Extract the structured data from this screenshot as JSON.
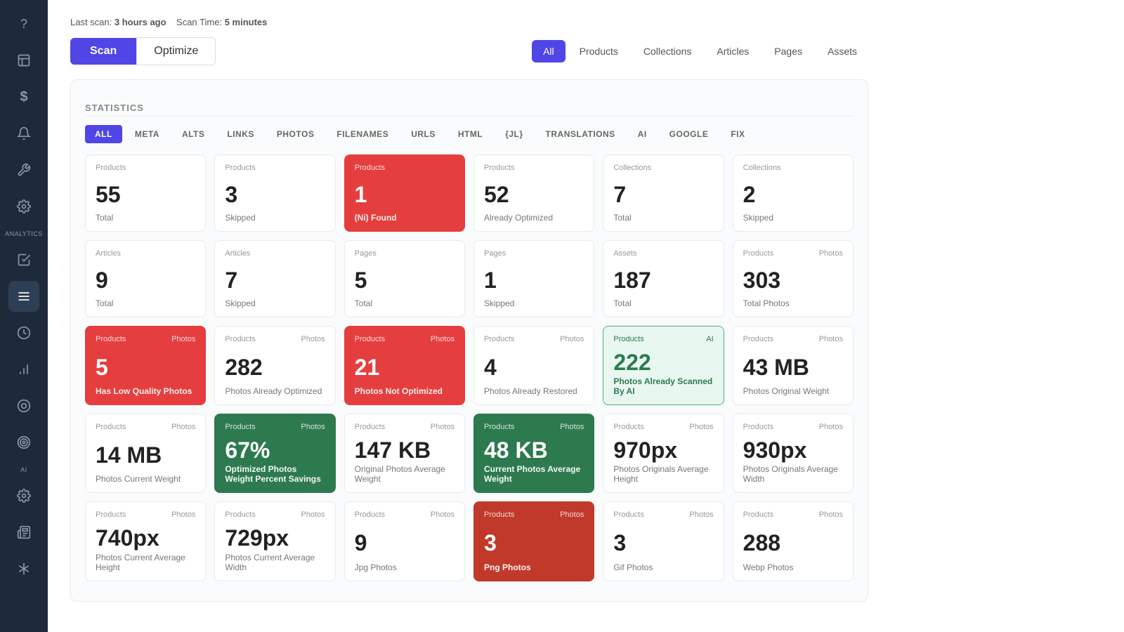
{
  "sidebar": {
    "icons": [
      {
        "name": "help-icon",
        "symbol": "?",
        "active": false
      },
      {
        "name": "log-icon",
        "symbol": "📋",
        "active": false
      },
      {
        "name": "dollar-icon",
        "symbol": "$",
        "active": false
      },
      {
        "name": "notification-icon",
        "symbol": "🔔",
        "active": false
      },
      {
        "name": "tools-icon",
        "symbol": "🔧",
        "active": false
      },
      {
        "name": "settings-icon",
        "symbol": "⚙",
        "active": false
      },
      {
        "name": "analytics-label",
        "symbol": "ANALYTICS",
        "active": false,
        "isLabel": true
      },
      {
        "name": "checklist-icon",
        "symbol": "☑",
        "active": false
      },
      {
        "name": "list-icon",
        "symbol": "☰",
        "active": true
      },
      {
        "name": "clock-icon",
        "symbol": "🕐",
        "active": false
      },
      {
        "name": "bar-chart-icon",
        "symbol": "📊",
        "active": false
      },
      {
        "name": "circle-icon",
        "symbol": "◎",
        "active": false
      },
      {
        "name": "target-icon",
        "symbol": "🎯",
        "active": false
      },
      {
        "name": "ai-label",
        "symbol": "AI",
        "active": false,
        "isLabel": true
      },
      {
        "name": "gear2-icon",
        "symbol": "⚙",
        "active": false
      },
      {
        "name": "newspaper-icon",
        "symbol": "📰",
        "active": false
      },
      {
        "name": "asterisk-icon",
        "symbol": "✳",
        "active": false
      }
    ]
  },
  "header": {
    "last_scan_label": "Last scan:",
    "last_scan_value": "3 hours ago",
    "scan_time_label": "Scan Time:",
    "scan_time_value": "5 minutes",
    "scan_button": "Scan",
    "optimize_button": "Optimize"
  },
  "filter_tabs": [
    {
      "label": "All",
      "active": true
    },
    {
      "label": "Products",
      "active": false
    },
    {
      "label": "Collections",
      "active": false
    },
    {
      "label": "Articles",
      "active": false
    },
    {
      "label": "Pages",
      "active": false
    },
    {
      "label": "Assets",
      "active": false
    }
  ],
  "statistics": {
    "title": "STATISTICS",
    "tabs": [
      {
        "label": "ALL",
        "active": true
      },
      {
        "label": "META",
        "active": false
      },
      {
        "label": "ALTS",
        "active": false
      },
      {
        "label": "LINKS",
        "active": false
      },
      {
        "label": "PHOTOS",
        "active": false
      },
      {
        "label": "FILENAMES",
        "active": false
      },
      {
        "label": "URLS",
        "active": false
      },
      {
        "label": "HTML",
        "active": false
      },
      {
        "label": "{JL}",
        "active": false
      },
      {
        "label": "TRANSLATIONS",
        "active": false
      },
      {
        "label": "AI",
        "active": false
      },
      {
        "label": "GOOGLE",
        "active": false
      },
      {
        "label": "FIX",
        "active": false
      }
    ]
  },
  "cards_row1": [
    {
      "category": "Products",
      "subcategory": "",
      "value": "55",
      "label": "Total",
      "style": "normal"
    },
    {
      "category": "Products",
      "subcategory": "",
      "value": "3",
      "label": "Skipped",
      "style": "normal"
    },
    {
      "category": "Products",
      "subcategory": "",
      "value": "1",
      "label": "(Ni) Found",
      "style": "red"
    },
    {
      "category": "Products",
      "subcategory": "",
      "value": "52",
      "label": "Already Optimized",
      "style": "normal"
    },
    {
      "category": "Collections",
      "subcategory": "",
      "value": "7",
      "label": "Total",
      "style": "normal"
    },
    {
      "category": "Collections",
      "subcategory": "",
      "value": "2",
      "label": "Skipped",
      "style": "normal"
    }
  ],
  "cards_row2": [
    {
      "category": "Articles",
      "subcategory": "",
      "value": "9",
      "label": "Total",
      "style": "normal"
    },
    {
      "category": "Articles",
      "subcategory": "",
      "value": "7",
      "label": "Skipped",
      "style": "normal"
    },
    {
      "category": "Pages",
      "subcategory": "",
      "value": "5",
      "label": "Total",
      "style": "normal"
    },
    {
      "category": "Pages",
      "subcategory": "",
      "value": "1",
      "label": "Skipped",
      "style": "normal"
    },
    {
      "category": "Assets",
      "subcategory": "",
      "value": "187",
      "label": "Total",
      "style": "normal"
    },
    {
      "category": "Products",
      "subcategory": "Photos",
      "value": "303",
      "label": "Total Photos",
      "style": "normal"
    }
  ],
  "cards_row3": [
    {
      "category": "Products",
      "subcategory": "Photos",
      "value": "5",
      "label": "Has Low Quality Photos",
      "style": "red"
    },
    {
      "category": "Products",
      "subcategory": "Photos",
      "value": "282",
      "label": "Photos Already Optimized",
      "style": "normal"
    },
    {
      "category": "Products",
      "subcategory": "Photos",
      "value": "21",
      "label": "Photos Not Optimized",
      "style": "red"
    },
    {
      "category": "Products",
      "subcategory": "Photos",
      "value": "4",
      "label": "Photos Already Restored",
      "style": "normal"
    },
    {
      "category": "Products",
      "subcategory": "AI",
      "value": "222",
      "label": "Photos Already Scanned By AI",
      "style": "green"
    },
    {
      "category": "Products",
      "subcategory": "Photos",
      "value": "43 MB",
      "label": "Photos Original Weight",
      "style": "normal"
    }
  ],
  "cards_row4": [
    {
      "category": "Products",
      "subcategory": "Photos",
      "value": "14 MB",
      "label": "Photos Current Weight",
      "style": "normal"
    },
    {
      "category": "Products",
      "subcategory": "Photos",
      "value": "67%",
      "label": "Optimized Photos Weight Percent Savings",
      "style": "dark-green"
    },
    {
      "category": "Products",
      "subcategory": "Photos",
      "value": "147 KB",
      "label": "Original Photos Average Weight",
      "style": "normal"
    },
    {
      "category": "Products",
      "subcategory": "Photos",
      "value": "48 KB",
      "label": "Current Photos Average Weight",
      "style": "dark-green"
    },
    {
      "category": "Products",
      "subcategory": "Photos",
      "value": "970px",
      "label": "Photos Originals Average Height",
      "style": "normal"
    },
    {
      "category": "Products",
      "subcategory": "Photos",
      "value": "930px",
      "label": "Photos Originals Average Width",
      "style": "normal"
    }
  ],
  "cards_row5": [
    {
      "category": "Products",
      "subcategory": "Photos",
      "value": "740px",
      "label": "Photos Current Average Height",
      "style": "normal"
    },
    {
      "category": "Products",
      "subcategory": "Photos",
      "value": "729px",
      "label": "Photos Current Average Width",
      "style": "normal"
    },
    {
      "category": "Products",
      "subcategory": "Photos",
      "value": "9",
      "label": "Jpg Photos",
      "style": "normal"
    },
    {
      "category": "Products",
      "subcategory": "Photos",
      "value": "3",
      "label": "Png Photos",
      "style": "dark-red"
    },
    {
      "category": "Products",
      "subcategory": "Photos",
      "value": "3",
      "label": "Gif Photos",
      "style": "normal"
    },
    {
      "category": "Products",
      "subcategory": "Photos",
      "value": "288",
      "label": "Webp Photos",
      "style": "normal"
    }
  ]
}
